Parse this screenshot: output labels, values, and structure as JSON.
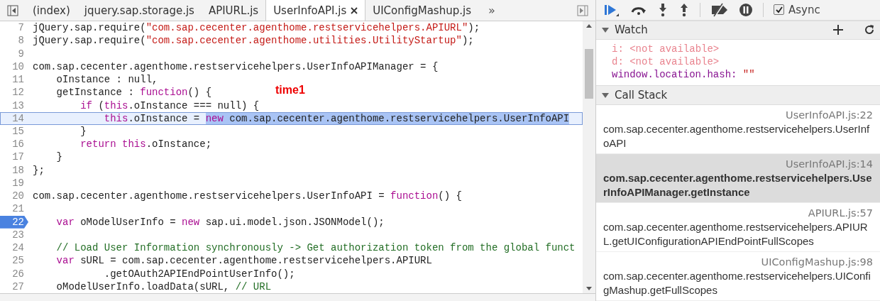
{
  "tabs": [
    {
      "label": "(index)",
      "selected": false,
      "closable": false
    },
    {
      "label": "jquery.sap.storage.js",
      "selected": false,
      "closable": false
    },
    {
      "label": "APIURL.js",
      "selected": false,
      "closable": false
    },
    {
      "label": "UserInfoAPI.js",
      "selected": true,
      "closable": true
    },
    {
      "label": "UIConfigMashup.js",
      "selected": false,
      "closable": false
    }
  ],
  "more_tabs": "»",
  "code": {
    "lines": [
      {
        "number": "7",
        "current": false,
        "breakpoint": false,
        "segments": [
          {
            "text": "jQuery.sap.require(",
            "kind": "plain"
          },
          {
            "text": "\"com.sap.cecenter.agenthome.restservicehelpers.APIURL\"",
            "kind": "string"
          },
          {
            "text": ");",
            "kind": "plain"
          }
        ]
      },
      {
        "number": "8",
        "current": false,
        "breakpoint": false,
        "segments": [
          {
            "text": "jQuery.sap.require(",
            "kind": "plain"
          },
          {
            "text": "\"com.sap.cecenter.agenthome.utilities.UtilityStartup\"",
            "kind": "string"
          },
          {
            "text": ");",
            "kind": "plain"
          }
        ]
      },
      {
        "number": "9",
        "current": false,
        "breakpoint": false
      },
      {
        "number": "10",
        "current": false,
        "breakpoint": false,
        "segments": [
          {
            "text": "com.sap.cecenter.agenthome.restservicehelpers.UserInfoAPIManager = {",
            "kind": "plain"
          }
        ]
      },
      {
        "number": "11",
        "current": false,
        "breakpoint": false,
        "segments": [
          {
            "text": "    oInstance : null,",
            "kind": "plain"
          }
        ]
      },
      {
        "number": "12",
        "current": false,
        "breakpoint": false,
        "segments": [
          {
            "text": "    getInstance : ",
            "kind": "plain"
          },
          {
            "text": "function",
            "kind": "keyword"
          },
          {
            "text": "() {",
            "kind": "plain"
          }
        ]
      },
      {
        "number": "13",
        "current": false,
        "breakpoint": false,
        "segments": [
          {
            "text": "        if",
            "kind": "keyword"
          },
          {
            "text": " (",
            "kind": "plain"
          },
          {
            "text": "this",
            "kind": "keyword"
          },
          {
            "text": ".oInstance === null) {",
            "kind": "plain"
          }
        ]
      },
      {
        "number": "14",
        "current": true,
        "breakpoint": false,
        "segments": [
          {
            "text": "            this",
            "kind": "keyword"
          },
          {
            "text": ".oInstance = ",
            "kind": "plain"
          }
        ],
        "selected_segments": [
          {
            "text": "new",
            "kind": "keyword"
          },
          {
            "text": " com.sap.cecenter.agenthome.restservicehelpers.UserInfoAPI",
            "kind": "plain"
          }
        ]
      },
      {
        "number": "15",
        "current": false,
        "breakpoint": false,
        "segments": [
          {
            "text": "        }",
            "kind": "plain"
          }
        ]
      },
      {
        "number": "16",
        "current": false,
        "breakpoint": false,
        "segments": [
          {
            "text": "        return this",
            "kind": "keyword"
          },
          {
            "text": ".oInstance;",
            "kind": "plain"
          }
        ]
      },
      {
        "number": "17",
        "current": false,
        "breakpoint": false,
        "segments": [
          {
            "text": "    }",
            "kind": "plain"
          }
        ]
      },
      {
        "number": "18",
        "current": false,
        "breakpoint": false,
        "segments": [
          {
            "text": "};",
            "kind": "plain"
          }
        ]
      },
      {
        "number": "19",
        "current": false,
        "breakpoint": false
      },
      {
        "number": "20",
        "current": false,
        "breakpoint": false,
        "segments": [
          {
            "text": "com.sap.cecenter.agenthome.restservicehelpers.UserInfoAPI = ",
            "kind": "plain"
          },
          {
            "text": "function",
            "kind": "keyword"
          },
          {
            "text": "() {",
            "kind": "plain"
          }
        ]
      },
      {
        "number": "21",
        "current": false,
        "breakpoint": false
      },
      {
        "number": "22",
        "current": false,
        "breakpoint": true,
        "segments": [
          {
            "text": "    var",
            "kind": "keyword"
          },
          {
            "text": " oModelUserInfo = ",
            "kind": "plain"
          },
          {
            "text": "new",
            "kind": "keyword"
          },
          {
            "text": " sap.ui.model.json.JSONModel();",
            "kind": "plain"
          }
        ]
      },
      {
        "number": "23",
        "current": false,
        "breakpoint": false
      },
      {
        "number": "24",
        "current": false,
        "breakpoint": false,
        "segments": [
          {
            "text": "    // Load User Information synchronously -> Get authorization token from the global funct",
            "kind": "comment"
          }
        ]
      },
      {
        "number": "25",
        "current": false,
        "breakpoint": false,
        "segments": [
          {
            "text": "    var",
            "kind": "keyword"
          },
          {
            "text": " sURL = com.sap.cecenter.agenthome.restservicehelpers.APIURL",
            "kind": "plain"
          }
        ]
      },
      {
        "number": "26",
        "current": false,
        "breakpoint": false,
        "segments": [
          {
            "text": "            .getOAuth2APIEndPointUserInfo();",
            "kind": "plain"
          }
        ]
      },
      {
        "number": "27",
        "current": false,
        "breakpoint": false,
        "segments": [
          {
            "text": "    oModelUserInfo.loadData(sURL, ",
            "kind": "plain"
          },
          {
            "text": "// URL",
            "kind": "comment"
          }
        ]
      }
    ]
  },
  "annotation": "time1",
  "async": {
    "label": "Async",
    "checked": true
  },
  "watch": {
    "title": "Watch",
    "expanded": true,
    "items": [
      {
        "name": "i:",
        "value": "<not available>",
        "kind": "unavailable"
      },
      {
        "name": "d:",
        "value": "<not available>",
        "kind": "unavailable"
      },
      {
        "name": "window.location.hash:",
        "value": "\"\"",
        "kind": "value"
      }
    ]
  },
  "call_stack": {
    "title": "Call Stack",
    "expanded": true,
    "frames": [
      {
        "location": "UserInfoAPI.js:22",
        "function": "com.sap.cecenter.agenthome.restservicehelpers.UserInfoAPI",
        "selected": false
      },
      {
        "location": "UserInfoAPI.js:14",
        "function": "com.sap.cecenter.agenthome.restservicehelpers.UserInfoAPIManager.getInstance",
        "selected": true
      },
      {
        "location": "APIURL.js:57",
        "function": "com.sap.cecenter.agenthome.restservicehelpers.APIURL.getUIConfigurationAPIEndPointFullScopes",
        "selected": false
      },
      {
        "location": "UIConfigMashup.js:98",
        "function": "com.sap.cecenter.agenthome.restservicehelpers.UIConfigMashup.getFullScopes",
        "selected": false
      }
    ]
  }
}
